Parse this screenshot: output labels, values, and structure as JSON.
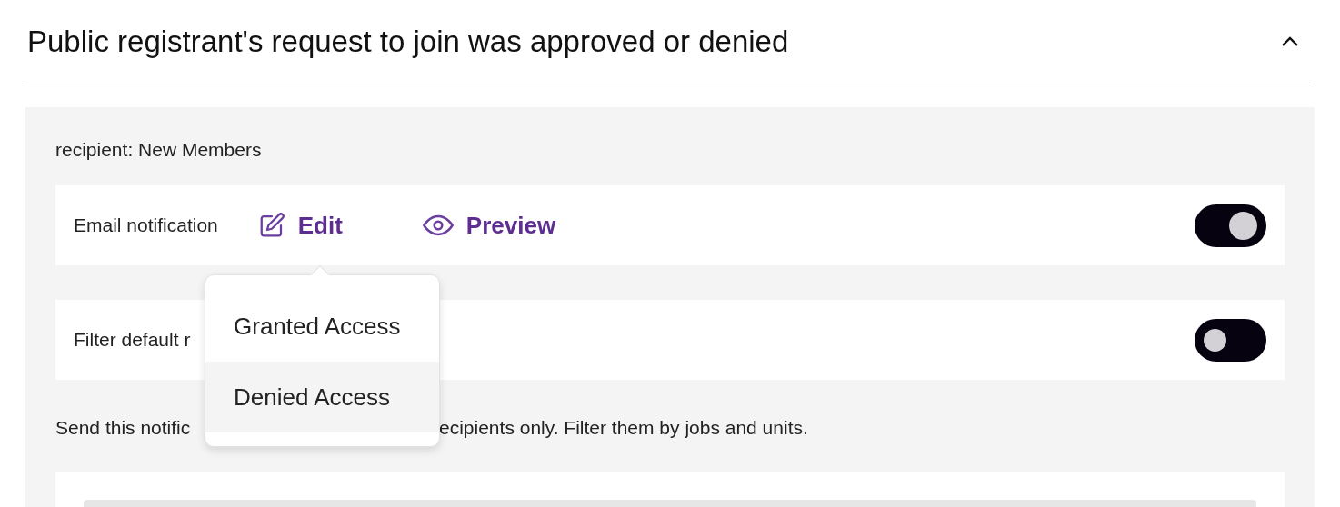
{
  "section": {
    "title": "Public registrant's request to join was approved or denied",
    "expanded": true
  },
  "recipient": "recipient: New Members",
  "rows": [
    {
      "label": "Email notification",
      "on": true,
      "actions": [
        {
          "kind": "edit",
          "label": "Edit"
        },
        {
          "kind": "preview",
          "label": "Preview"
        }
      ]
    },
    {
      "label": "Filter default r",
      "on": false,
      "actions": []
    }
  ],
  "menu": {
    "items": [
      {
        "label": "Granted Access",
        "selected": false
      },
      {
        "label": "Denied Access",
        "selected": true
      }
    ]
  },
  "note": {
    "before": "Send this notific",
    "after": "ecipients only. Filter them by jobs and units."
  }
}
